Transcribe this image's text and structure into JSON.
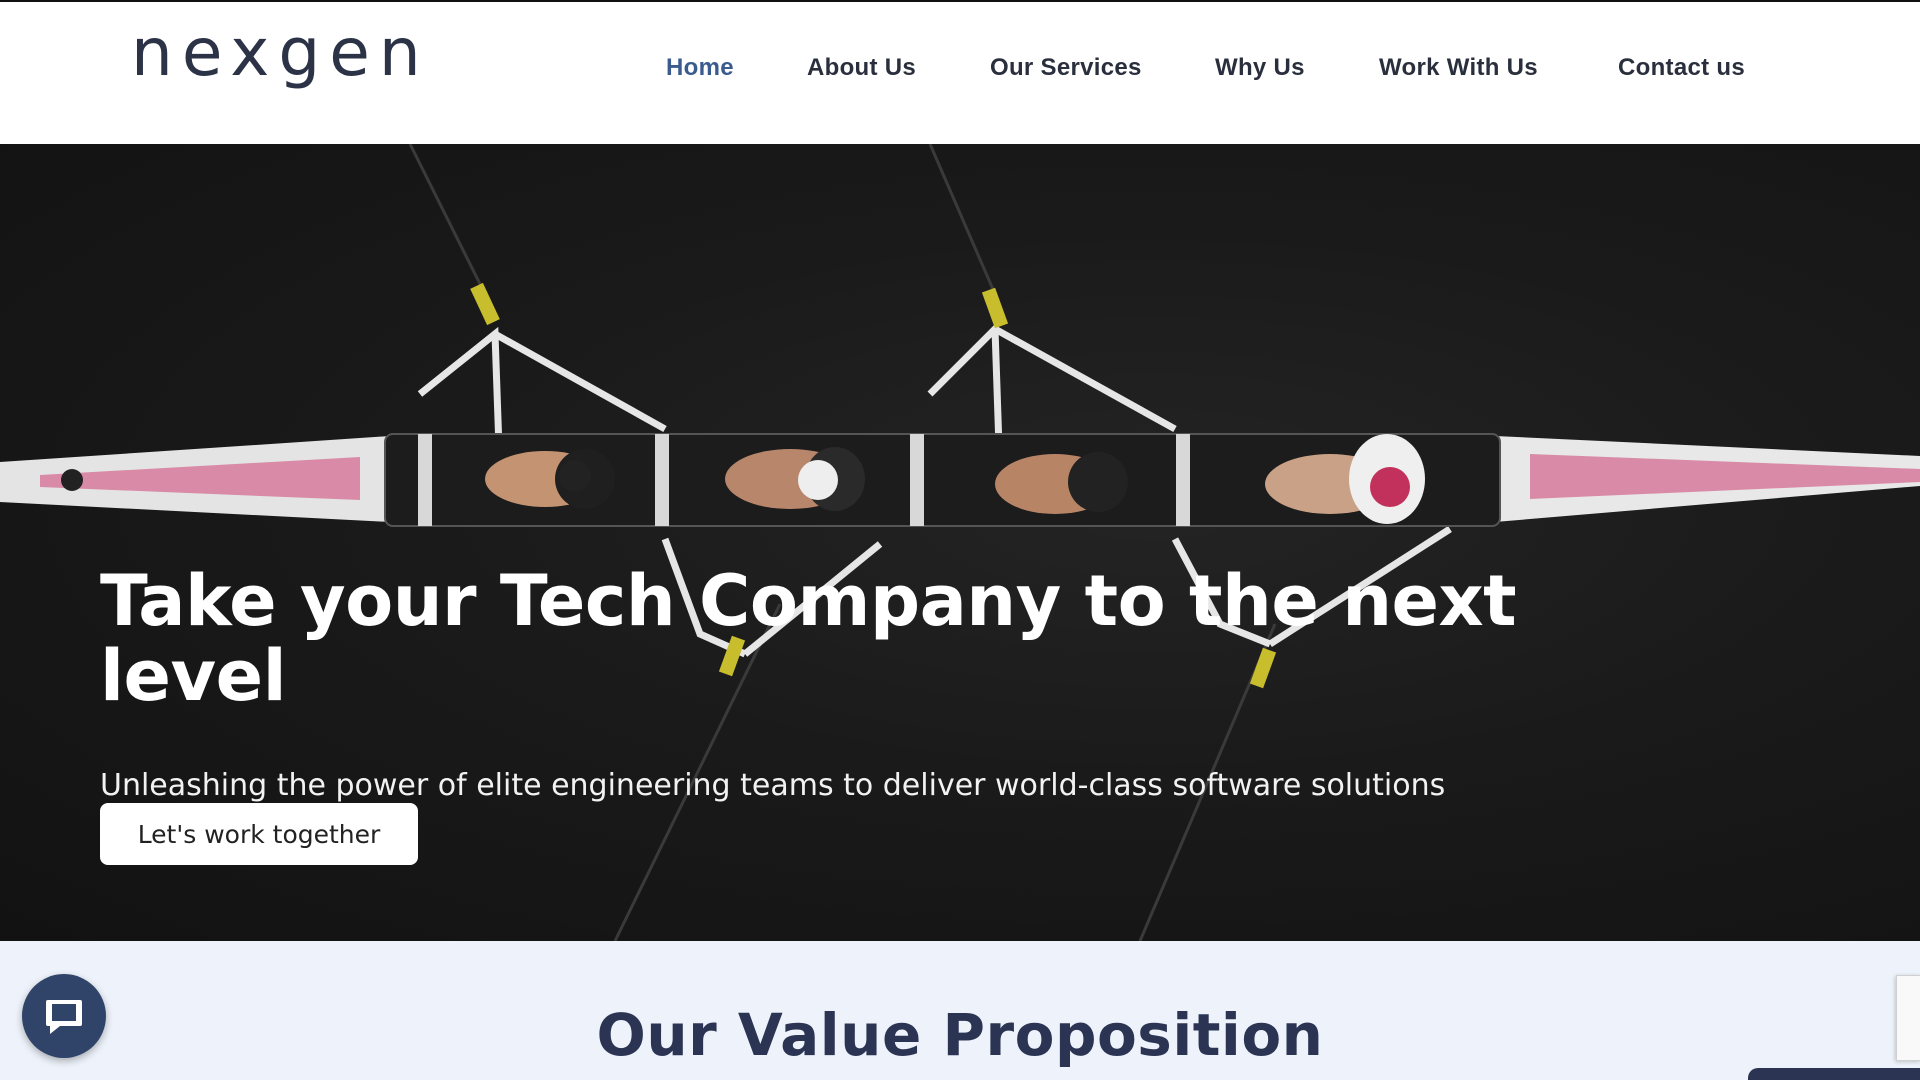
{
  "brand": {
    "logo_text": "nexgen"
  },
  "nav": {
    "items": [
      {
        "label": "Home",
        "active": true
      },
      {
        "label": "About Us",
        "active": false
      },
      {
        "label": "Our Services",
        "active": false
      },
      {
        "label": "Why Us",
        "active": false
      },
      {
        "label": "Work With Us",
        "active": false
      },
      {
        "label": "Contact us",
        "active": false
      }
    ]
  },
  "hero": {
    "title": "Take your Tech Company to the next level",
    "subtitle": "Unleashing the power of elite engineering teams to deliver world-class software solutions",
    "cta_label": "Let's work together",
    "background_image": "aerial-view-rowing-boat"
  },
  "value_section": {
    "heading": "Our Value Proposition"
  },
  "widgets": {
    "chat_icon": "chat-bubble-icon"
  },
  "colors": {
    "nav_active": "#3b5b8f",
    "nav_text": "#2a2f3d",
    "heading_navy": "#2b3553",
    "chat_button": "#2f4468",
    "section_bg": "#eef3fb",
    "hero_text": "#ffffff"
  }
}
